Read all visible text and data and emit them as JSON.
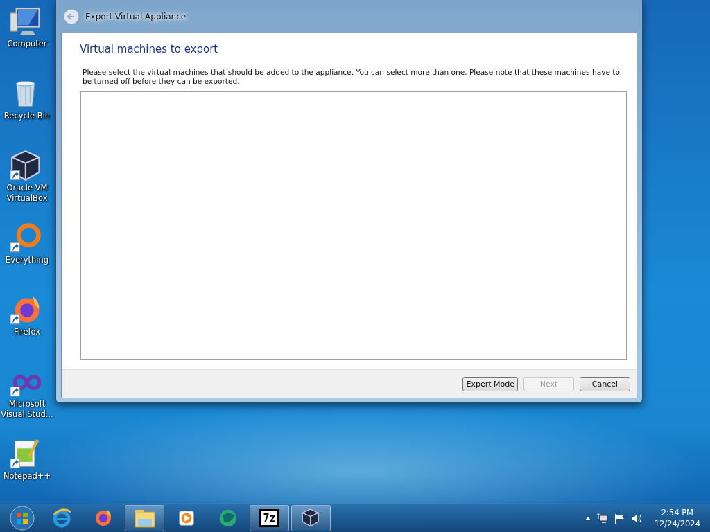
{
  "desktop_icons": [
    {
      "label": "Computer",
      "kind": "computer",
      "shortcut": false
    },
    {
      "label": "Recycle Bin",
      "kind": "recycle-bin",
      "shortcut": false
    },
    {
      "label": "Oracle VM VirtualBox",
      "kind": "cube",
      "shortcut": true
    },
    {
      "label": "Everything",
      "kind": "ring",
      "shortcut": true
    },
    {
      "label": "Firefox",
      "kind": "fox",
      "shortcut": true
    },
    {
      "label": "Microsoft Visual Stud...",
      "kind": "infinity",
      "shortcut": true
    },
    {
      "label": "Notepad++",
      "kind": "notepad",
      "shortcut": true
    }
  ],
  "window": {
    "title": "Export Virtual Appliance",
    "heading": "Virtual machines to export",
    "description": "Please select the virtual machines that should be added to the appliance. You can select more than one. Please note that these machines have to be turned off before they can be exported.",
    "buttons": [
      {
        "label": "Expert Mode",
        "disabled": false
      },
      {
        "label": "Next",
        "disabled": true
      },
      {
        "label": "Cancel",
        "disabled": false
      }
    ]
  },
  "taskbar": {
    "items": [
      {
        "kind": "start",
        "running": false
      },
      {
        "kind": "globe",
        "running": false
      },
      {
        "kind": "fox",
        "running": false
      },
      {
        "kind": "folder",
        "running": true
      },
      {
        "kind": "play",
        "running": false
      },
      {
        "kind": "green-orb",
        "running": false
      },
      {
        "kind": "archive",
        "running": true,
        "text": "7z"
      },
      {
        "kind": "cube",
        "running": true
      }
    ],
    "time": "2:54 PM",
    "date": "12/24/2024"
  }
}
